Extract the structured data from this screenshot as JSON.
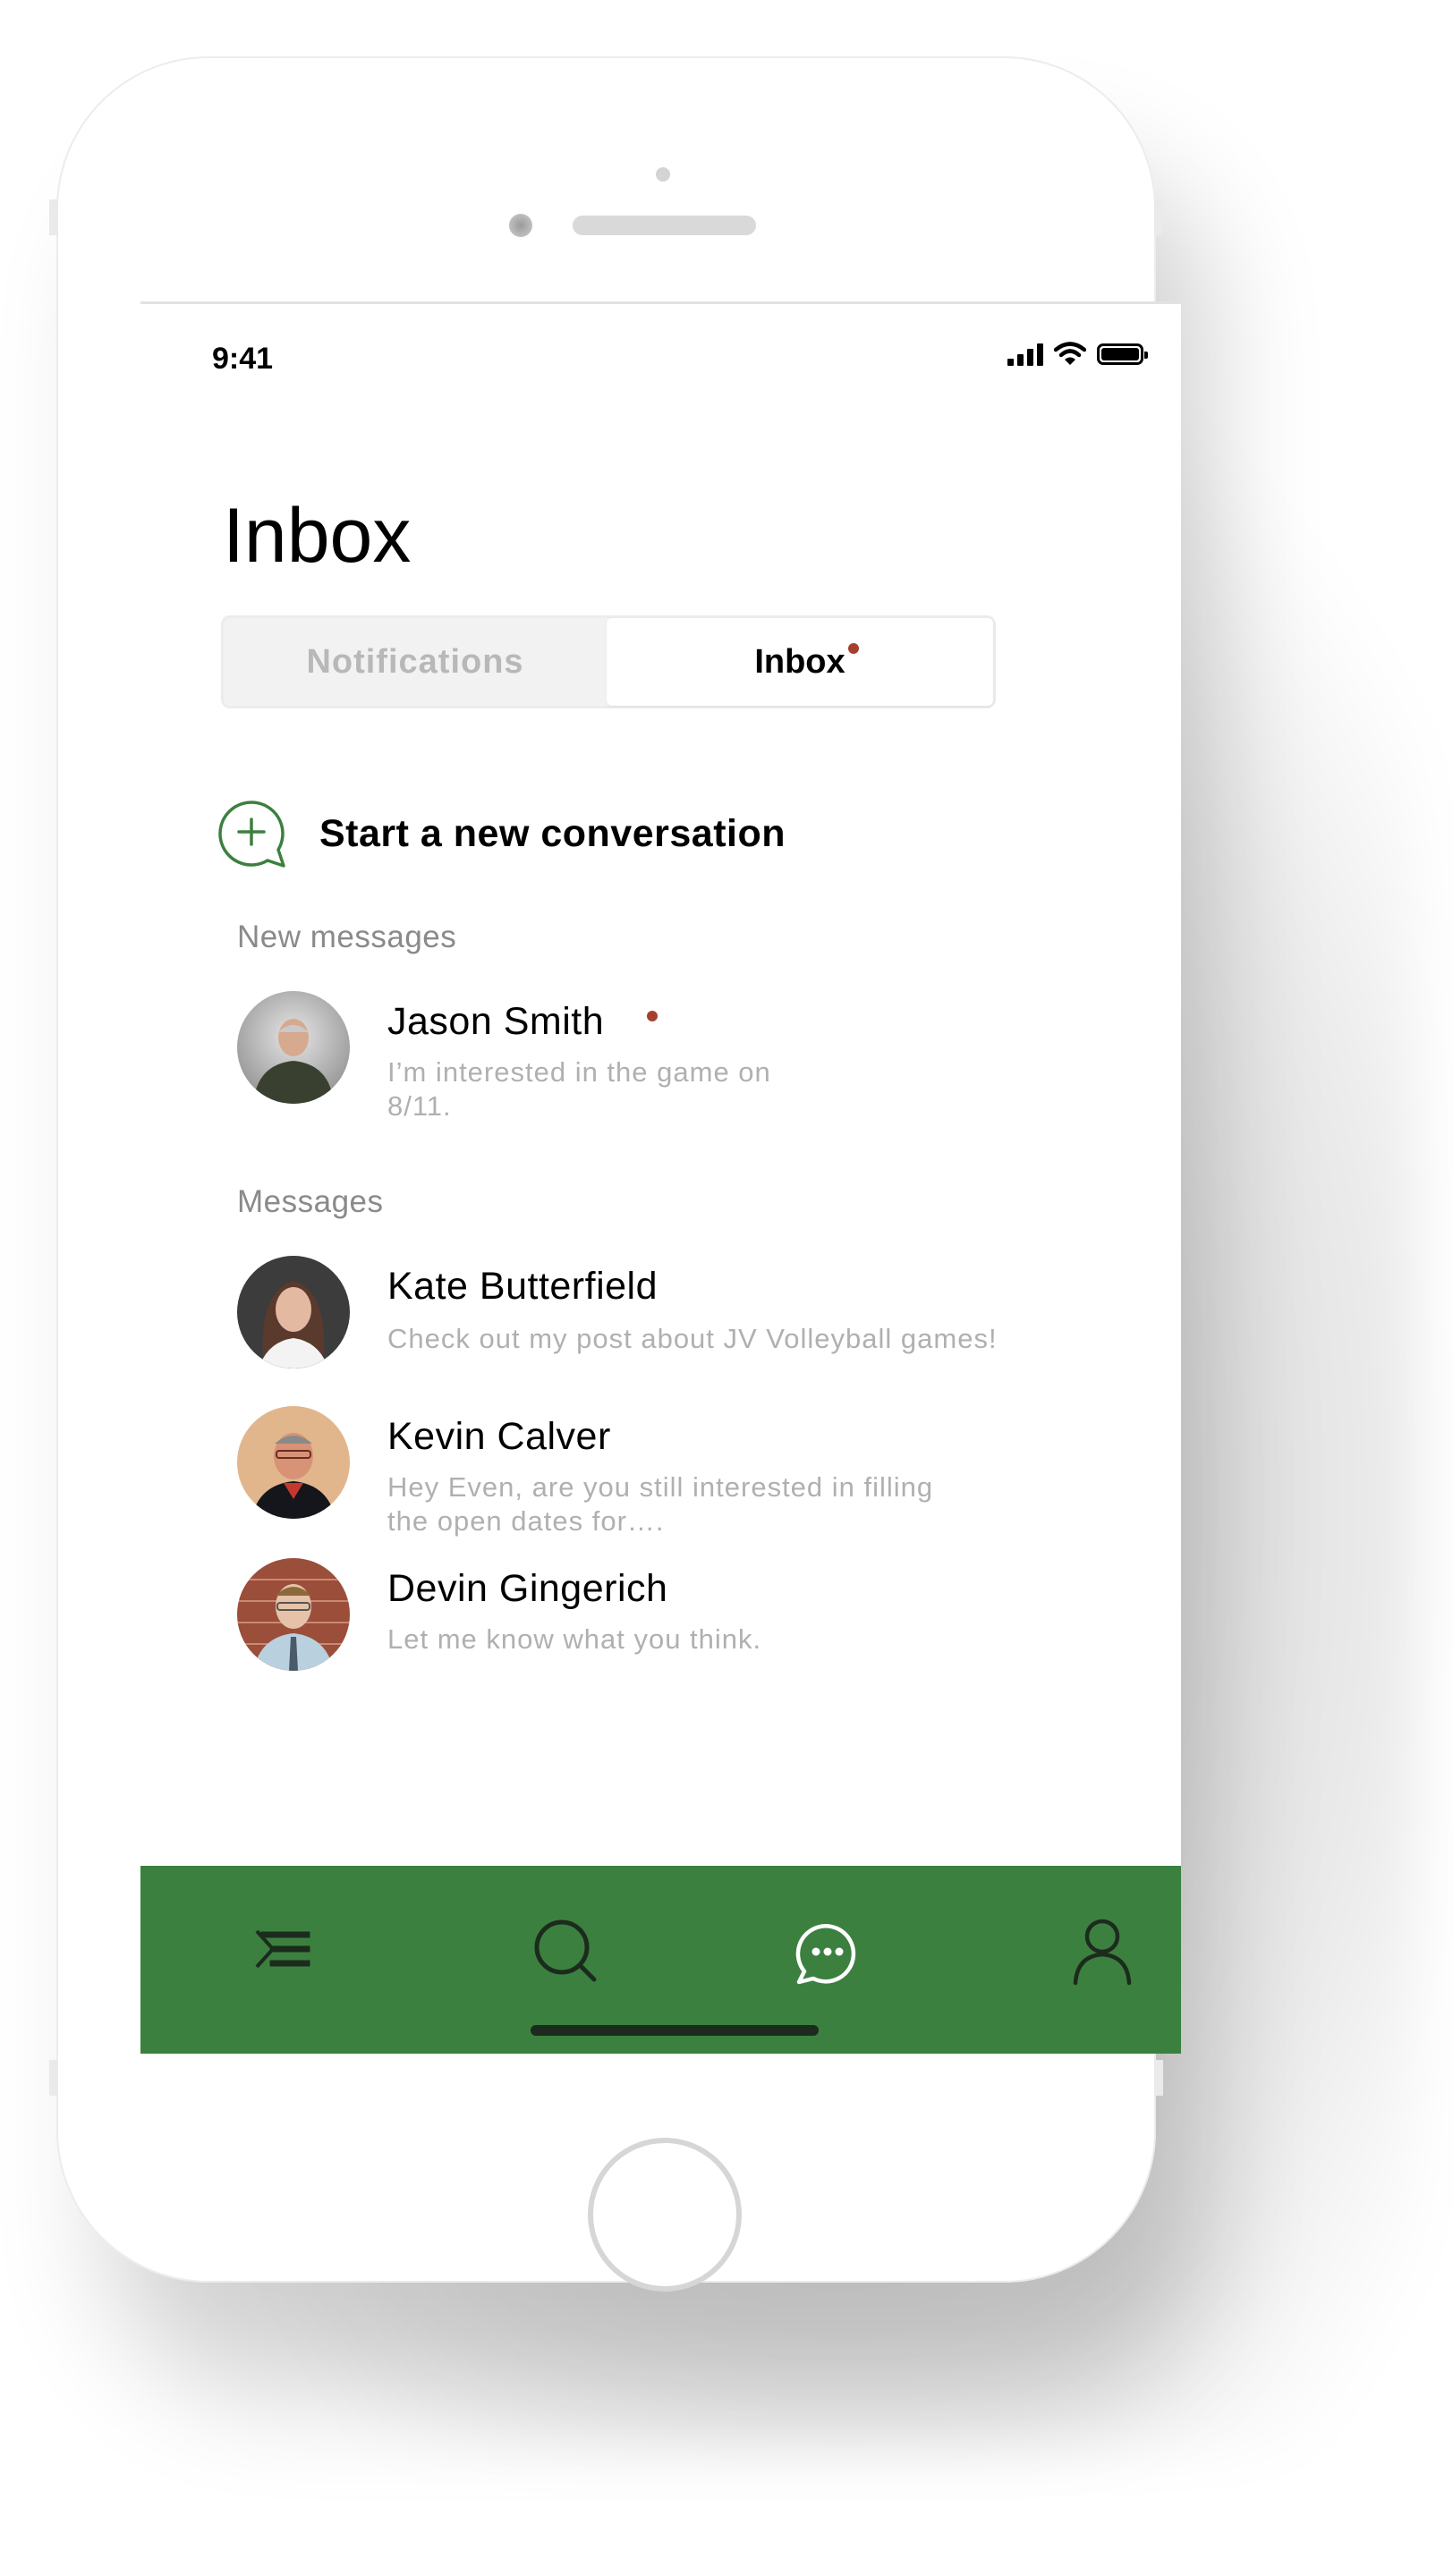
{
  "status_bar": {
    "time": "9:41"
  },
  "header": {
    "title": "Inbox"
  },
  "tabs": {
    "notifications_label": "Notifications",
    "inbox_label": "Inbox"
  },
  "actions": {
    "new_conversation_label": "Start a new conversation"
  },
  "sections": {
    "new_messages_label": "New messages",
    "messages_label": "Messages"
  },
  "new_messages": [
    {
      "name": "Jason Smith",
      "preview": "I’m interested in the game on 8/11.",
      "unread": true
    }
  ],
  "messages": [
    {
      "name": "Kate Butterfield",
      "preview": "Check out my post about JV Volleyball games!"
    },
    {
      "name": "Kevin Calver",
      "preview": "Hey Even, are you still interested in filling the open dates for…."
    },
    {
      "name": "Devin Gingerich",
      "preview": "Let me know what you think."
    }
  ],
  "tab_bar": {
    "items": [
      "menu-icon",
      "search-icon",
      "chat-icon",
      "profile-icon"
    ],
    "active": "chat-icon"
  },
  "colors": {
    "brand_green": "#3b803f",
    "unread_dot": "#a5402f",
    "tab_icon_inactive": "#1c2b1d",
    "tab_icon_active": "#ffffff"
  }
}
